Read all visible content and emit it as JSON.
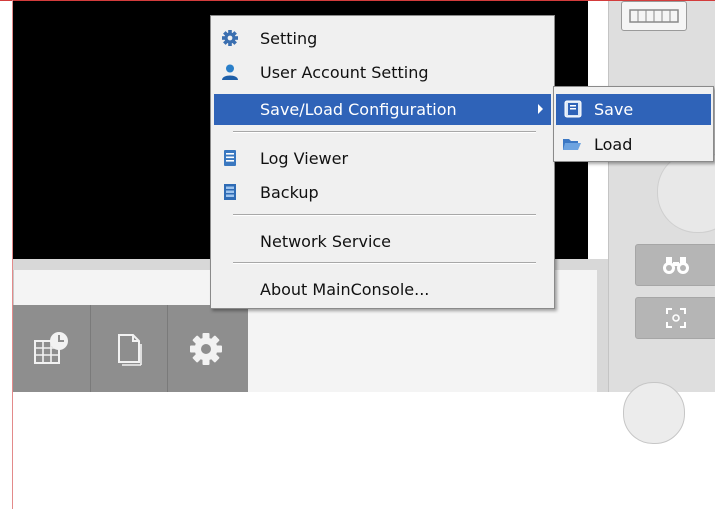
{
  "menu": {
    "items": [
      {
        "label": "Setting",
        "icon": "gear-icon"
      },
      {
        "label": "User Account Setting",
        "icon": "user-icon"
      },
      {
        "label": "Save/Load Configuration",
        "icon": "",
        "highlighted": true,
        "has_submenu": true
      },
      {
        "label": "Log Viewer",
        "icon": "log-icon"
      },
      {
        "label": "Backup",
        "icon": "backup-icon"
      },
      {
        "label": "Network Service",
        "icon": ""
      },
      {
        "label": "About MainConsole...",
        "icon": ""
      }
    ]
  },
  "submenu": {
    "items": [
      {
        "label": "Save",
        "icon": "save-icon",
        "highlighted": true
      },
      {
        "label": "Load",
        "icon": "folder-open-icon"
      }
    ]
  },
  "toolbar": {
    "buttons": [
      {
        "icon": "schedule-grid-icon"
      },
      {
        "icon": "page-icon"
      },
      {
        "icon": "gear-icon"
      }
    ]
  },
  "side_panel": {
    "buttons": [
      {
        "icon": "layout-grid-icon"
      },
      {
        "icon": "binoculars-icon"
      },
      {
        "icon": "focus-icon"
      }
    ]
  },
  "colors": {
    "highlight": "#2f63b8",
    "menu_bg": "#f0f0f0",
    "video_bg": "#000000",
    "toolbar_bg": "#8e8e8e"
  }
}
